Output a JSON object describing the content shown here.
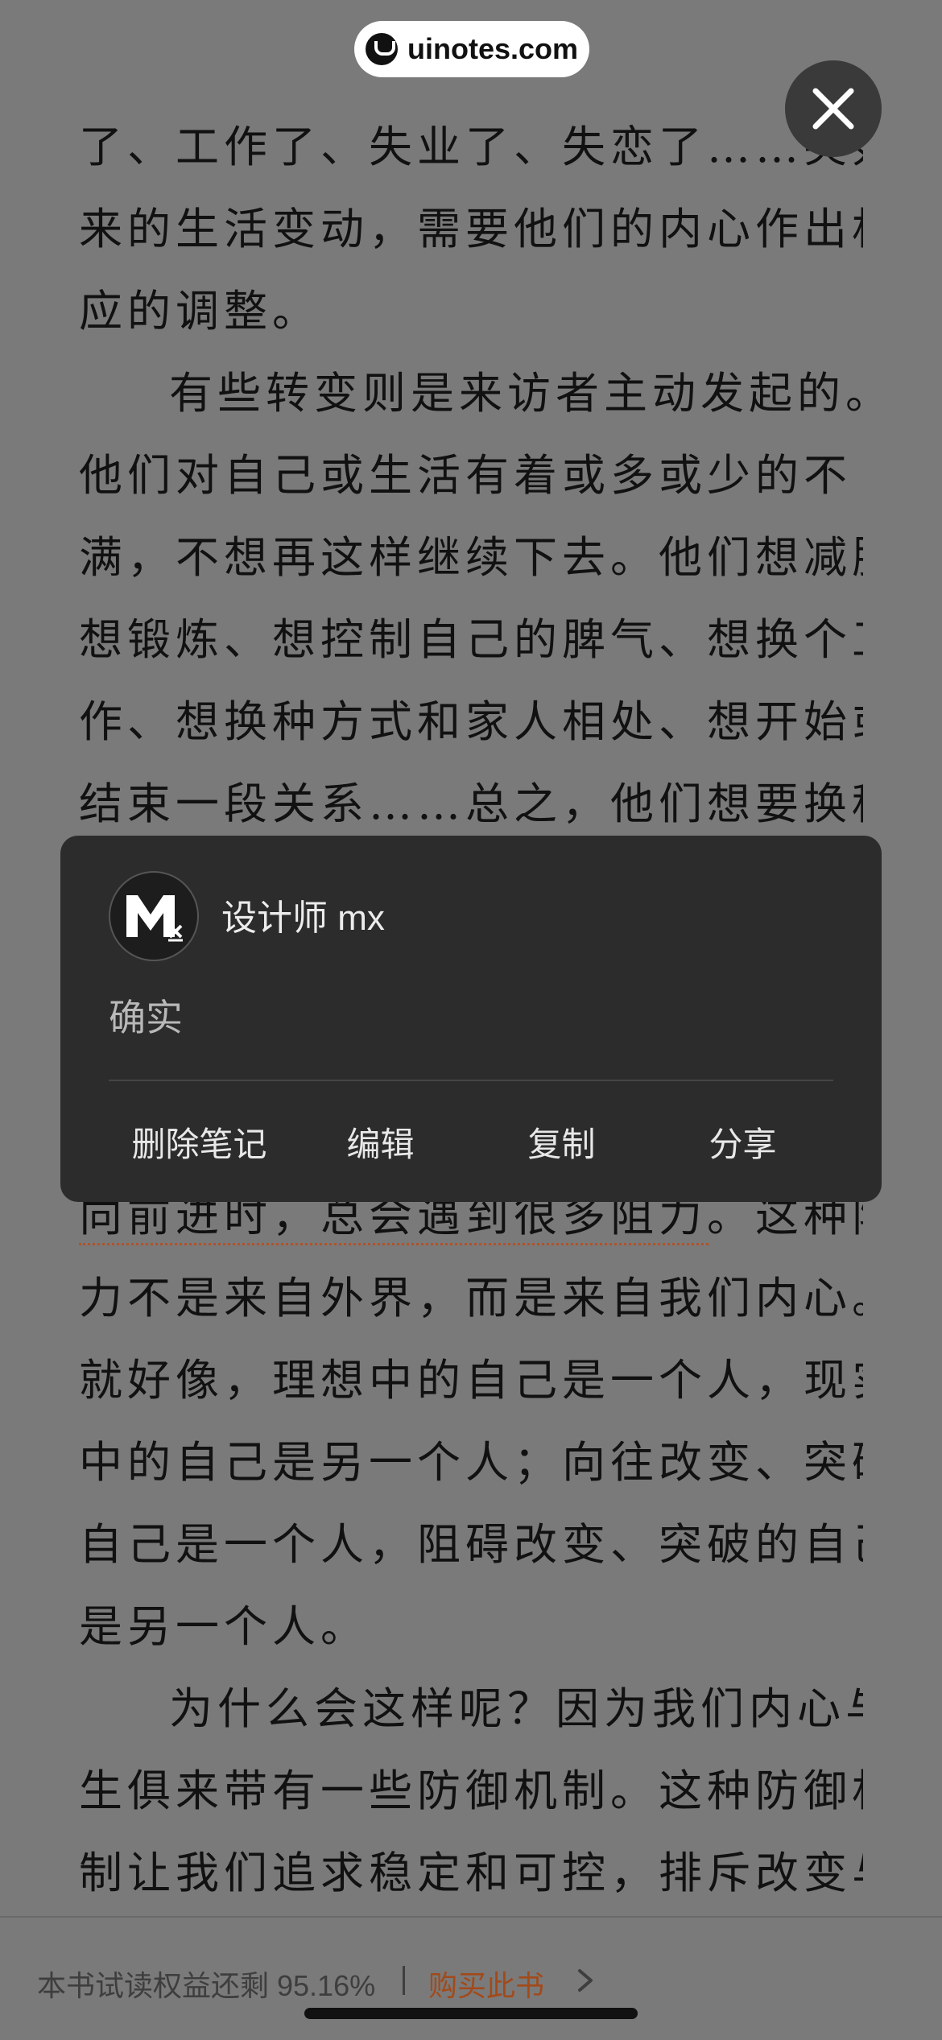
{
  "watermark": {
    "text": "uinotes.com"
  },
  "book": {
    "lines": [
      "了、工作了、失业了、失恋了……突如其",
      "来的生活变动，需要他们的内心作出相",
      "应的调整。",
      "有些转变则是来访者主动发起的。",
      "他们对自己或生活有着或多或少的不",
      "满，不想再这样继续下去。他们想减肥、",
      "想锻炼、想控制自己的脾气、想换个工",
      "作、想换种方式和家人相处、想开始或者",
      "结束一段关系……总之，他们想要换种",
      "向前进时，总会遇到很多阻力。这种阻",
      "力不是来自外界，而是来自我们内心。",
      "就好像，理想中的自己是一个人，现实",
      "中的自己是另一个人；向往改变、突破的",
      "自己是一个人，阻碍改变、突破的自己",
      "是另一个人。",
      "为什么会这样呢？因为我们内心与",
      "生俱来带有一些防御机制。这种防御机",
      "制让我们追求稳定和可控，排斥改变与"
    ]
  },
  "note_card": {
    "author": "设计师 mx",
    "note": "确实",
    "actions": [
      "删除笔记",
      "编辑",
      "复制",
      "分享"
    ]
  },
  "bottom_bar": {
    "trial_text": "本书试读权益还剩 95.16%",
    "buy_label": "购买此书"
  },
  "colors": {
    "overlay": "#7a7a7a",
    "card": "#2c2c2c",
    "buy": "#a24a1a"
  }
}
